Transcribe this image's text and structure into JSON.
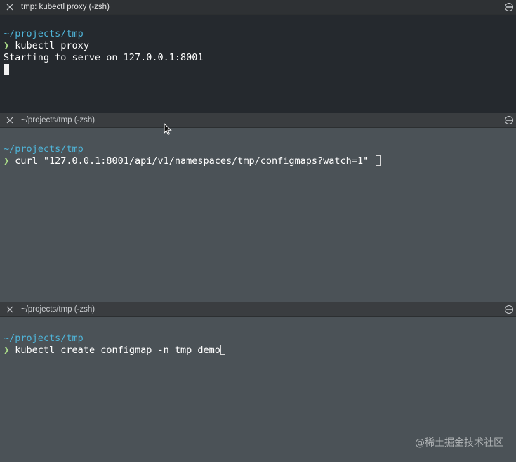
{
  "panes": [
    {
      "title": "tmp: kubectl proxy (-zsh)",
      "active": true,
      "lines": [
        {
          "type": "blank"
        },
        {
          "type": "path",
          "text": "~/projects/tmp"
        },
        {
          "type": "prompt",
          "glyph": "❯",
          "command": "kubectl proxy"
        },
        {
          "type": "output",
          "text": "Starting to serve on 127.0.0.1:8001"
        },
        {
          "type": "cursor"
        }
      ]
    },
    {
      "title": "~/projects/tmp (-zsh)",
      "active": false,
      "lines": [
        {
          "type": "blank"
        },
        {
          "type": "path",
          "text": "~/projects/tmp"
        },
        {
          "type": "prompt",
          "glyph": "❯",
          "command": "curl \"127.0.0.1:8001/api/v1/namespaces/tmp/configmaps?watch=1\" "
        }
      ]
    },
    {
      "title": "~/projects/tmp (-zsh)",
      "active": false,
      "lines": [
        {
          "type": "blank"
        },
        {
          "type": "path",
          "text": "~/projects/tmp"
        },
        {
          "type": "prompt",
          "glyph": "❯",
          "command": "kubectl create configmap -n tmp demo"
        }
      ]
    }
  ],
  "watermark": "@稀土掘金技术社区",
  "colors": {
    "active_pane_bg": "#25292e",
    "inactive_pane_bg": "#4b5257",
    "path": "#4fb4d8",
    "prompt": "#aee18a"
  }
}
